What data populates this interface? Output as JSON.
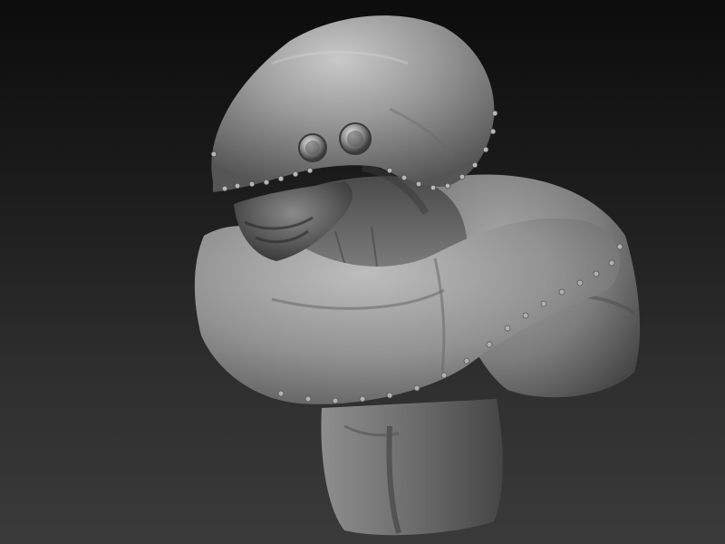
{
  "viewport": {
    "background_top": "#0c0c0c",
    "background_bottom": "#3a3a3a",
    "material_color": "#8a8a8a",
    "subject": "creature-bust-sculpt"
  }
}
